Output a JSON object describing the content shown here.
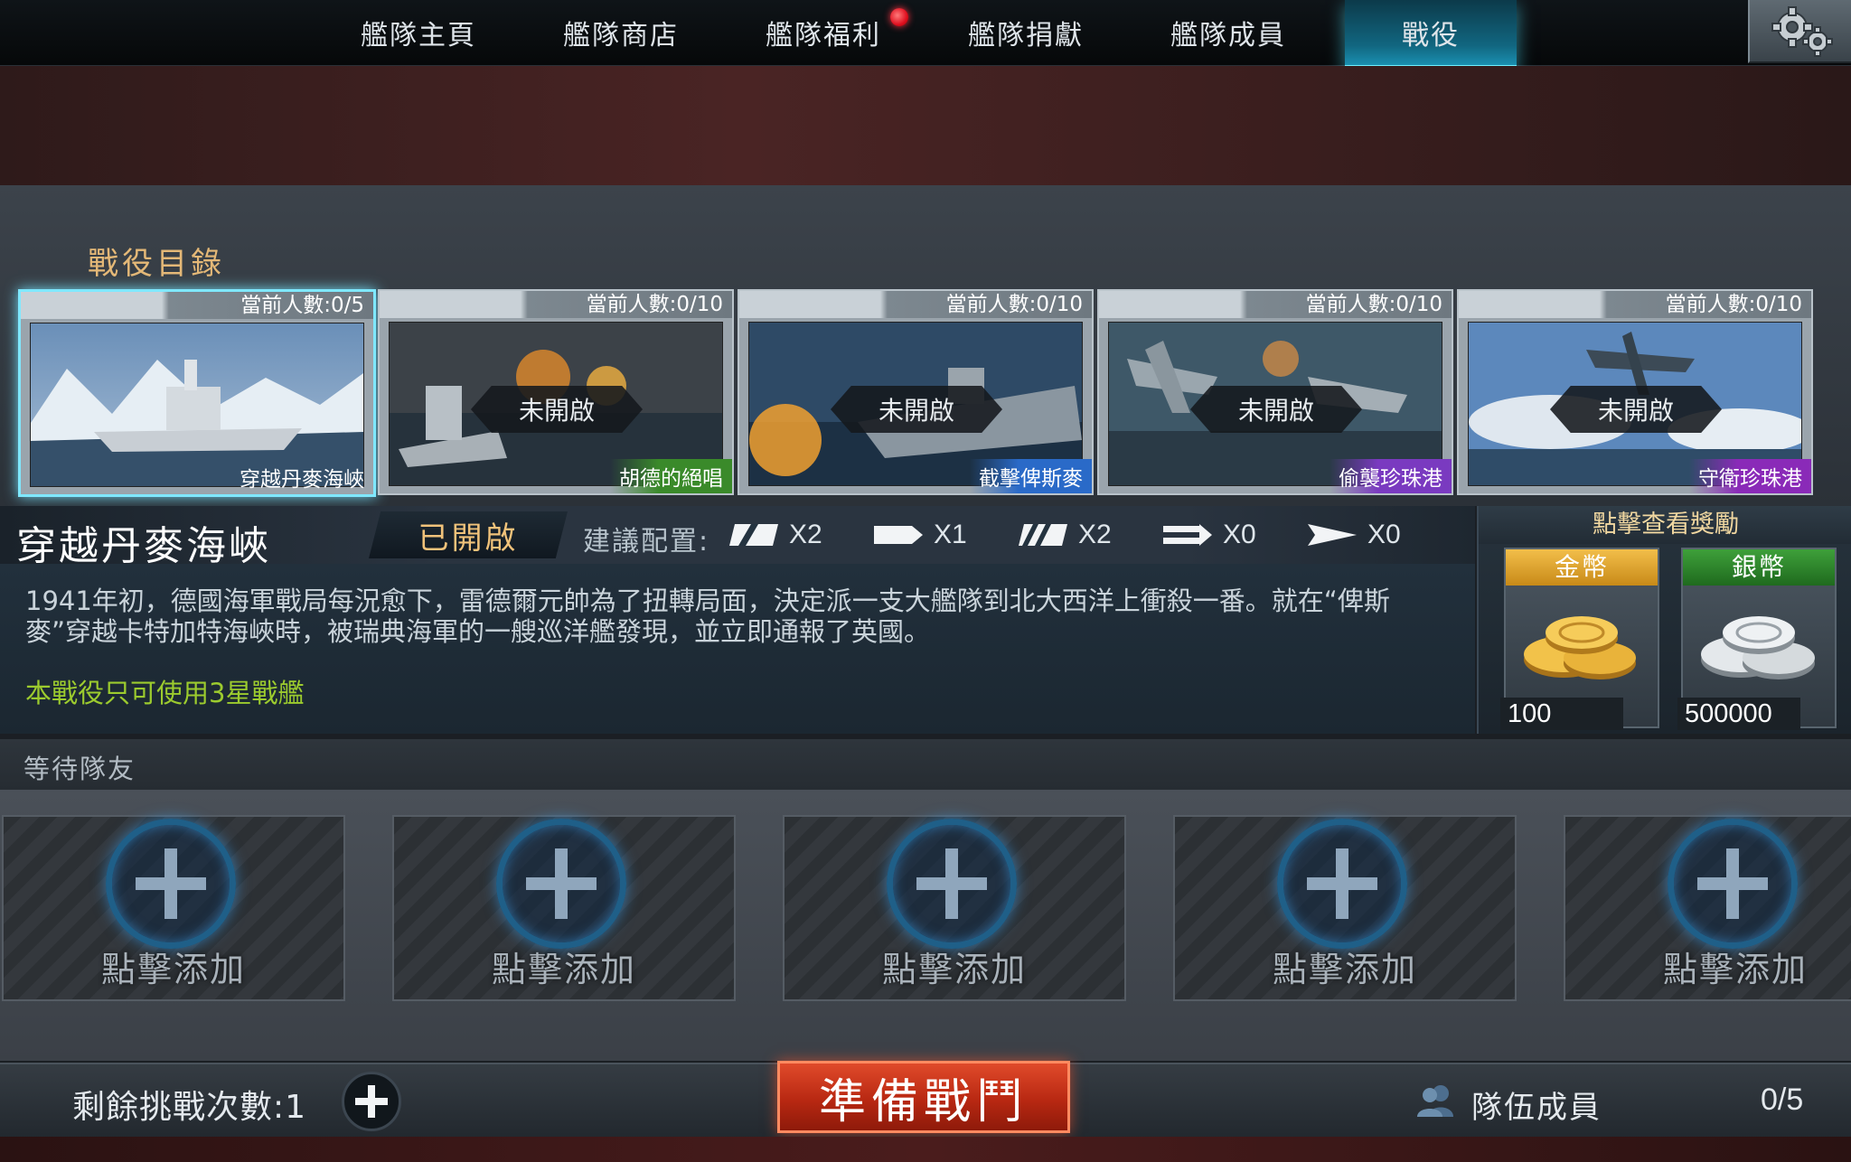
{
  "nav": {
    "tabs": [
      {
        "label": "艦隊主頁"
      },
      {
        "label": "艦隊商店"
      },
      {
        "label": "艦隊福利",
        "notification": true
      },
      {
        "label": "艦隊捐獻"
      },
      {
        "label": "艦隊成員"
      },
      {
        "label": "戰役",
        "active": true
      }
    ],
    "settings_icon": "gear-icon"
  },
  "campaign_list": {
    "title": "戰役目錄",
    "cards": [
      {
        "name": "穿越丹麥海峽",
        "count": "當前人數:0/5",
        "locked": false,
        "selected": true,
        "name_color": "#ffffff"
      },
      {
        "name": "胡德的絕唱",
        "count": "當前人數:0/10",
        "locked": true,
        "lock_label": "未開啟",
        "name_color": "#3a8a2a"
      },
      {
        "name": "截擊俾斯麥",
        "count": "當前人數:0/10",
        "locked": true,
        "lock_label": "未開啟",
        "name_color": "#2a6ac8"
      },
      {
        "name": "偷襲珍珠港",
        "count": "當前人數:0/10",
        "locked": true,
        "lock_label": "未開啟",
        "name_color": "#7a3ac0"
      },
      {
        "name": "守衛珍珠港",
        "count": "當前人數:0/10",
        "locked": true,
        "lock_label": "未開啟",
        "name_color": "#8a2ab8"
      }
    ]
  },
  "campaign_detail": {
    "name": "穿越丹麥海峽",
    "status": "已開啟",
    "recommend_label": "建議配置:",
    "recommend": [
      {
        "icon": "ship-class-icon-a",
        "count": "X2"
      },
      {
        "icon": "ship-class-icon-b",
        "count": "X1"
      },
      {
        "icon": "ship-class-icon-c",
        "count": "X2"
      },
      {
        "icon": "ship-class-icon-d",
        "count": "X0"
      },
      {
        "icon": "ship-class-icon-e",
        "count": "X0"
      }
    ],
    "description": "1941年初，德國海軍戰局每況愈下，雷德爾元帥為了扭轉局面，決定派一支大艦隊到北大西洋上衝殺一番。就在“俾斯麥”穿越卡特加特海峽時，被瑞典海軍的一艘巡洋艦發現，並立即通報了英國。",
    "restriction": "本戰役只可使用3星戰艦"
  },
  "rewards": {
    "title": "點擊查看獎勵",
    "items": [
      {
        "label": "金幣",
        "amount": "100",
        "color": "#e8a82a"
      },
      {
        "label": "銀幣",
        "amount": "500000",
        "color": "#2f8a2a"
      }
    ]
  },
  "waiting": {
    "label": "等待隊友",
    "slot_label": "點擊添加"
  },
  "footer": {
    "tries": "剩餘挑戰次數:1",
    "ready_button": "準備戰鬥",
    "team_label": "隊伍成員",
    "team_count": "0/5"
  }
}
